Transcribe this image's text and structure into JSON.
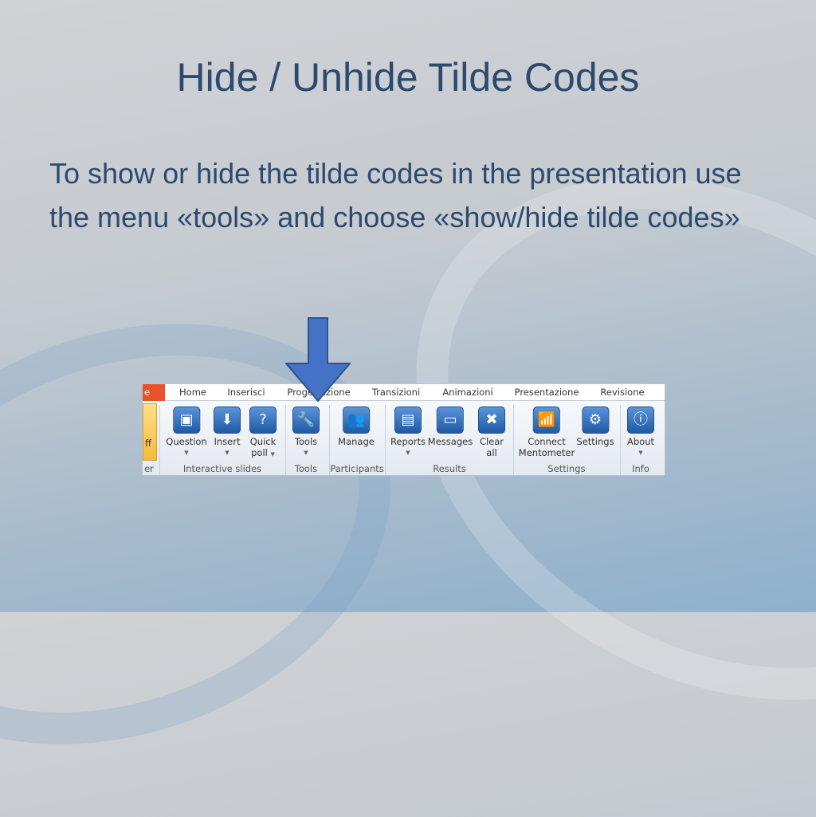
{
  "slide": {
    "title": "Hide / Unhide Tilde Codes",
    "body": "To show or hide the tilde codes in the presentation use the menu «tools» and choose «show/hide tilde codes»"
  },
  "ribbon": {
    "file_tab": "e",
    "tabs": [
      "Home",
      "Inserisci",
      "Progettazione",
      "Transizioni",
      "Animazioni",
      "Presentazione",
      "Revisione"
    ],
    "partial_button": "ff",
    "partial_group": "er",
    "buttons": [
      {
        "label": "Question",
        "icon": "question-slide-icon",
        "dropdown": true
      },
      {
        "label": "Insert",
        "icon": "insert-slide-icon",
        "dropdown": true
      },
      {
        "label": "Quick",
        "label2": "poll",
        "icon": "quick-poll-icon",
        "dropdown": true
      },
      {
        "label": "Tools",
        "icon": "wrench-icon",
        "dropdown": true
      },
      {
        "label": "Manage",
        "icon": "participants-icon",
        "dropdown": false
      },
      {
        "label": "Reports",
        "icon": "reports-icon",
        "dropdown": true
      },
      {
        "label": "Messages",
        "icon": "messages-icon",
        "dropdown": false
      },
      {
        "label": "Clear",
        "label2": "all",
        "icon": "clear-icon",
        "dropdown": false
      },
      {
        "label": "Connect",
        "label2": "Mentometer",
        "icon": "antenna-icon",
        "dropdown": false
      },
      {
        "label": "Settings",
        "icon": "gears-icon",
        "dropdown": false
      },
      {
        "label": "About",
        "icon": "info-icon",
        "dropdown": true
      }
    ],
    "groups": [
      "Interactive slides",
      "Tools",
      "Participants",
      "Results",
      "Settings",
      "Info"
    ]
  },
  "colors": {
    "title": "#2c4a6e",
    "arrow": "#4472c4",
    "file_tab": "#e8532a"
  }
}
